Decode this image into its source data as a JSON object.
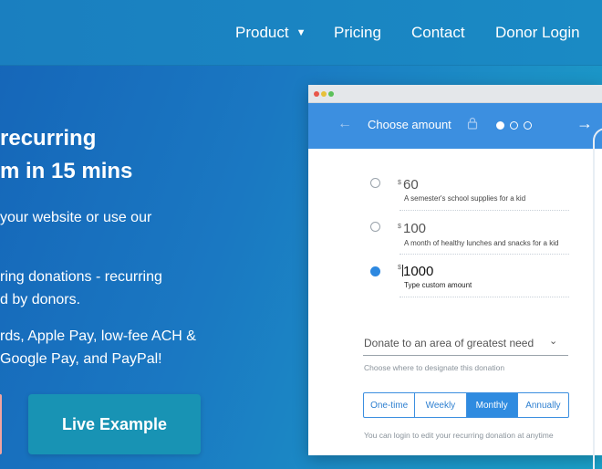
{
  "nav": {
    "product": "Product",
    "pricing": "Pricing",
    "contact": "Contact",
    "donor_login": "Donor Login"
  },
  "hero": {
    "title_line1": "recurring",
    "title_line2": "m in 15 mins",
    "sub_line1": "your website or use our",
    "bullet1_line1": "ring donations - recurring",
    "bullet1_line2": "d by donors.",
    "bullet2_line1": "rds, Apple Pay, low-fee ACH &",
    "bullet2_line2": "Google Pay, and PayPal!",
    "live_example": "Live Example"
  },
  "widget": {
    "header_title": "Choose amount",
    "options": [
      {
        "currency": "$",
        "amount": "60",
        "description": "A semester's school supplies for a kid"
      },
      {
        "currency": "$",
        "amount": "100",
        "description": "A month of healthy lunches and snacks for a kid"
      },
      {
        "currency": "$",
        "amount": "1000",
        "description": "Type custom amount"
      }
    ],
    "designation": "Donate to an area of greatest need",
    "designation_hint": "Choose where to designate this donation",
    "frequency": [
      "One-time",
      "Weekly",
      "Monthly",
      "Annually"
    ],
    "selected_frequency": "Monthly",
    "recurring_hint": "You can login to edit your recurring donation at anytime"
  },
  "colors": {
    "widget_header": "#3c8fe0",
    "live_button": "#1893b4",
    "selected_radio": "#2d88e0"
  }
}
